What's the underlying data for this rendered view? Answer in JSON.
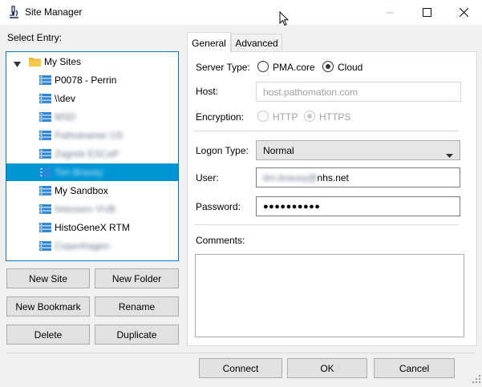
{
  "window": {
    "title": "Site Manager"
  },
  "left": {
    "select_entry_label": "Select Entry:",
    "tree": {
      "folder_label": "My Sites",
      "sites": [
        {
          "label": "P0078 - Perrin",
          "redacted": false,
          "selected": false
        },
        {
          "label": "\\\\dev",
          "redacted": false,
          "selected": false
        },
        {
          "label": "MSD",
          "redacted": true,
          "selected": false
        },
        {
          "label": "Pathotrainer US",
          "redacted": true,
          "selected": false
        },
        {
          "label": "Zagreb ESCaP",
          "redacted": true,
          "selected": false
        },
        {
          "label": "Tim Bravey",
          "redacted": true,
          "selected": true
        },
        {
          "label": "My Sandbox",
          "redacted": false,
          "selected": false
        },
        {
          "label": "histoserv VUB",
          "redacted": true,
          "selected": false
        },
        {
          "label": "HistoGeneX RTM",
          "redacted": false,
          "selected": false
        },
        {
          "label": "Copenhagen",
          "redacted": true,
          "selected": false
        }
      ]
    },
    "buttons": {
      "new_site": "New Site",
      "new_folder": "New Folder",
      "new_bookmark": "New Bookmark",
      "rename": "Rename",
      "delete": "Delete",
      "duplicate": "Duplicate"
    }
  },
  "tabs": {
    "general": "General",
    "advanced": "Advanced",
    "active": "General"
  },
  "form": {
    "server_type_label": "Server Type:",
    "server_type_options": [
      "PMA.core",
      "Cloud"
    ],
    "server_type_selected": "Cloud",
    "host_label": "Host:",
    "host_placeholder": "host.pathomation.com",
    "encryption_label": "Encryption:",
    "encryption_options": [
      "HTTP",
      "HTTPS"
    ],
    "encryption_selected": "HTTPS",
    "logon_type_label": "Logon Type:",
    "logon_type_value": "Normal",
    "user_label": "User:",
    "user_value_redacted": "tim.bravey@",
    "user_value_visible": "nhs.net",
    "password_label": "Password:",
    "password_value": "●●●●●●●●●●",
    "comments_label": "Comments:",
    "comments_value": ""
  },
  "footer": {
    "connect": "Connect",
    "ok": "OK",
    "cancel": "Cancel"
  }
}
